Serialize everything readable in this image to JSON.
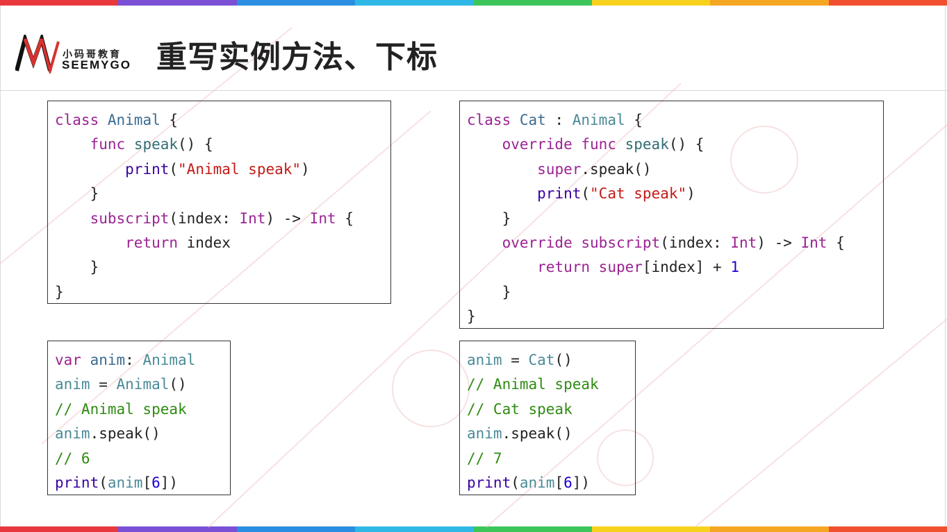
{
  "header": {
    "title": "重写实例方法、下标",
    "logo_cn": "小码哥教育",
    "logo_en": "SEEMYGO"
  },
  "colors": {
    "rainbow": [
      "#e8383d",
      "#7b4fd6",
      "#2a8fe0",
      "#2fb8e6",
      "#3cc65a",
      "#f7d21c",
      "#f5a623",
      "#f0502e"
    ]
  },
  "code_blocks": [
    {
      "lines": [
        [
          [
            "kw",
            "class"
          ],
          [
            "pl",
            " "
          ],
          [
            "ty",
            "Animal"
          ],
          [
            "pl",
            " {"
          ]
        ],
        [
          [
            "pl",
            "    "
          ],
          [
            "kw",
            "func"
          ],
          [
            "pl",
            " "
          ],
          [
            "fn",
            "speak"
          ],
          [
            "pl",
            "() {"
          ]
        ],
        [
          [
            "pl",
            "        "
          ],
          [
            "tx",
            "print"
          ],
          [
            "pl",
            "("
          ],
          [
            "st",
            "\"Animal speak\""
          ],
          [
            "pl",
            ")"
          ]
        ],
        [
          [
            "pl",
            "    }"
          ]
        ],
        [
          [
            "pl",
            "    "
          ],
          [
            "kw",
            "subscript"
          ],
          [
            "pl",
            "(index: "
          ],
          [
            "kw",
            "Int"
          ],
          [
            "pl",
            ") -> "
          ],
          [
            "kw",
            "Int"
          ],
          [
            "pl",
            " {"
          ]
        ],
        [
          [
            "pl",
            "        "
          ],
          [
            "kw",
            "return"
          ],
          [
            "pl",
            " index"
          ]
        ],
        [
          [
            "pl",
            "    }"
          ]
        ],
        [
          [
            "pl",
            "}"
          ]
        ]
      ]
    },
    {
      "lines": [
        [
          [
            "kw",
            "class"
          ],
          [
            "pl",
            " "
          ],
          [
            "ty",
            "Cat"
          ],
          [
            "pl",
            " : "
          ],
          [
            "vr",
            "Animal"
          ],
          [
            "pl",
            " {"
          ]
        ],
        [
          [
            "pl",
            "    "
          ],
          [
            "kw",
            "override"
          ],
          [
            "pl",
            " "
          ],
          [
            "kw",
            "func"
          ],
          [
            "pl",
            " "
          ],
          [
            "fn",
            "speak"
          ],
          [
            "pl",
            "() {"
          ]
        ],
        [
          [
            "pl",
            "        "
          ],
          [
            "kw",
            "super"
          ],
          [
            "pl",
            ".speak()"
          ]
        ],
        [
          [
            "pl",
            "        "
          ],
          [
            "tx",
            "print"
          ],
          [
            "pl",
            "("
          ],
          [
            "st",
            "\"Cat speak\""
          ],
          [
            "pl",
            ")"
          ]
        ],
        [
          [
            "pl",
            "    }"
          ]
        ],
        [
          [
            "pl",
            "    "
          ],
          [
            "kw",
            "override"
          ],
          [
            "pl",
            " "
          ],
          [
            "kw",
            "subscript"
          ],
          [
            "pl",
            "(index: "
          ],
          [
            "kw",
            "Int"
          ],
          [
            "pl",
            ") -> "
          ],
          [
            "kw",
            "Int"
          ],
          [
            "pl",
            " {"
          ]
        ],
        [
          [
            "pl",
            "        "
          ],
          [
            "kw",
            "return"
          ],
          [
            "pl",
            " "
          ],
          [
            "kw",
            "super"
          ],
          [
            "pl",
            "[index] + "
          ],
          [
            "nu",
            "1"
          ]
        ],
        [
          [
            "pl",
            "    }"
          ]
        ],
        [
          [
            "pl",
            "}"
          ]
        ]
      ]
    },
    {
      "lines": [
        [
          [
            "kw",
            "var"
          ],
          [
            "pl",
            " "
          ],
          [
            "ty",
            "anim"
          ],
          [
            "pl",
            ": "
          ],
          [
            "vr",
            "Animal"
          ]
        ],
        [
          [
            "vr",
            "anim"
          ],
          [
            "pl",
            " = "
          ],
          [
            "vr",
            "Animal"
          ],
          [
            "pl",
            "()"
          ]
        ],
        [
          [
            "cm",
            "// Animal speak"
          ]
        ],
        [
          [
            "vr",
            "anim"
          ],
          [
            "pl",
            ".speak()"
          ]
        ],
        [
          [
            "cm",
            "// 6"
          ]
        ],
        [
          [
            "tx",
            "print"
          ],
          [
            "pl",
            "("
          ],
          [
            "vr",
            "anim"
          ],
          [
            "pl",
            "["
          ],
          [
            "nu",
            "6"
          ],
          [
            "pl",
            "])"
          ]
        ]
      ]
    },
    {
      "lines": [
        [
          [
            "vr",
            "anim"
          ],
          [
            "pl",
            " = "
          ],
          [
            "vr",
            "Cat"
          ],
          [
            "pl",
            "()"
          ]
        ],
        [
          [
            "cm",
            "// Animal speak"
          ]
        ],
        [
          [
            "cm",
            "// Cat speak"
          ]
        ],
        [
          [
            "vr",
            "anim"
          ],
          [
            "pl",
            ".speak()"
          ]
        ],
        [
          [
            "cm",
            "// 7"
          ]
        ],
        [
          [
            "tx",
            "print"
          ],
          [
            "pl",
            "("
          ],
          [
            "vr",
            "anim"
          ],
          [
            "pl",
            "["
          ],
          [
            "nu",
            "6"
          ],
          [
            "pl",
            "])"
          ]
        ]
      ]
    }
  ]
}
